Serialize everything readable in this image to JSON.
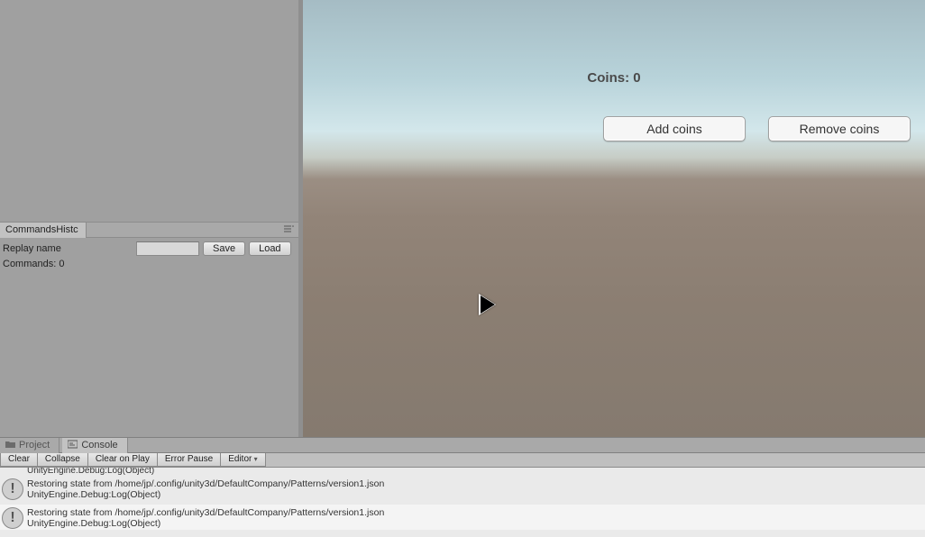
{
  "inspector": {
    "tab_label": "CommandsHistc",
    "replay_label": "Replay name",
    "replay_value": "",
    "save_label": "Save",
    "load_label": "Load",
    "commands_count_label": "Commands: 0"
  },
  "game": {
    "coins_label": "Coins: 0",
    "add_coins_label": "Add coins",
    "remove_coins_label": "Remove coins"
  },
  "bottom": {
    "project_tab": "Project",
    "console_tab": "Console",
    "toolbar": {
      "clear": "Clear",
      "collapse": "Collapse",
      "clear_on_play": "Clear on Play",
      "error_pause": "Error Pause",
      "editor": "Editor"
    },
    "logs": {
      "partial_top": "UnityEngine.Debug:Log(Object)",
      "entries": [
        {
          "line1": "Restoring state from /home/jp/.config/unity3d/DefaultCompany/Patterns/version1.json",
          "line2": "UnityEngine.Debug:Log(Object)"
        },
        {
          "line1": "Restoring state from /home/jp/.config/unity3d/DefaultCompany/Patterns/version1.json",
          "line2": "UnityEngine.Debug:Log(Object)"
        }
      ]
    }
  }
}
